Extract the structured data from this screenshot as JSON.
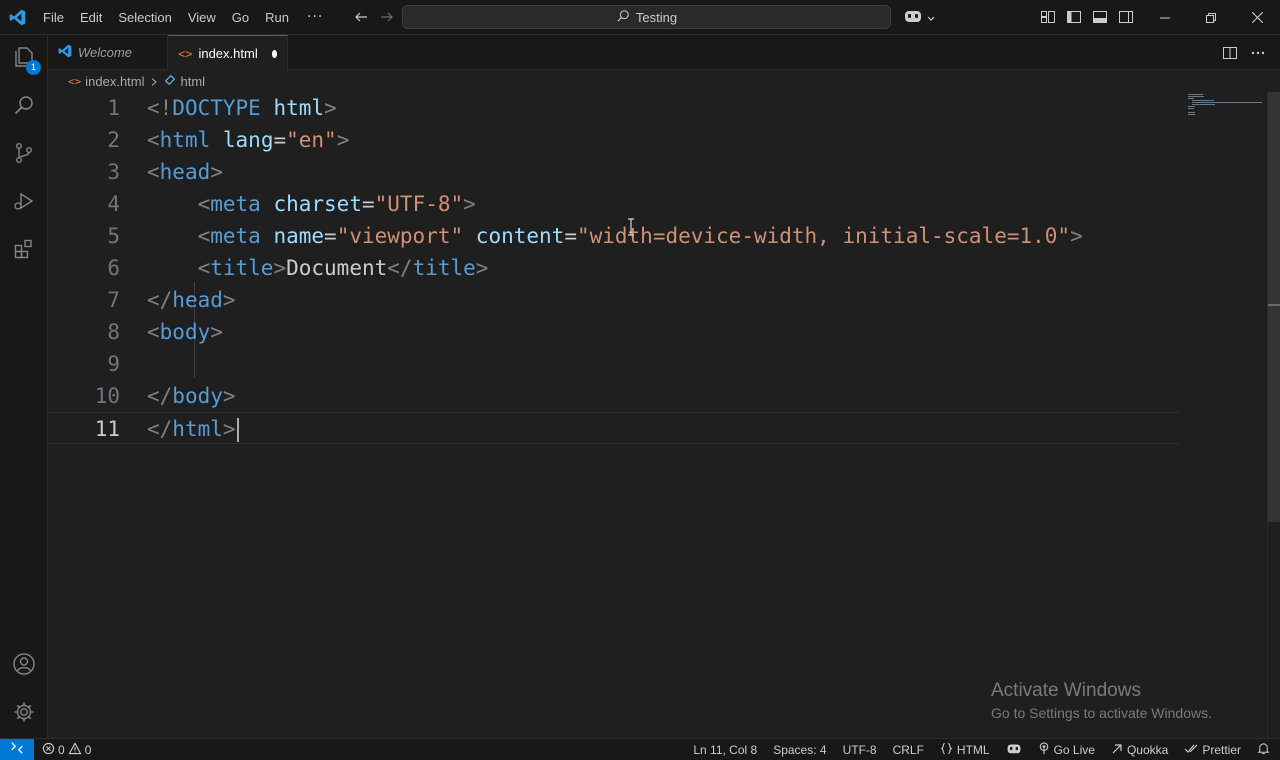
{
  "titlebar": {
    "menu": [
      "File",
      "Edit",
      "Selection",
      "View",
      "Go",
      "Run"
    ],
    "more_label": "···",
    "command_center": "Testing"
  },
  "activity_bar": {
    "explorer_badge": "1"
  },
  "tabs": [
    {
      "label": "Welcome",
      "active": false
    },
    {
      "label": "index.html",
      "active": true,
      "dirty": true
    }
  ],
  "breadcrumb": {
    "file": "index.html",
    "symbol": "html"
  },
  "editor": {
    "lines": [
      {
        "n": "1",
        "tokens": [
          [
            "punc",
            "<!"
          ],
          [
            "tag",
            "DOCTYPE"
          ],
          [
            "text",
            " "
          ],
          [
            "attr",
            "html"
          ],
          [
            "punc",
            ">"
          ]
        ]
      },
      {
        "n": "2",
        "tokens": [
          [
            "punc",
            "<"
          ],
          [
            "tag",
            "html"
          ],
          [
            "text",
            " "
          ],
          [
            "attr",
            "lang"
          ],
          [
            "text",
            "="
          ],
          [
            "str",
            "\"en\""
          ],
          [
            "punc",
            ">"
          ]
        ]
      },
      {
        "n": "3",
        "tokens": [
          [
            "punc",
            "<"
          ],
          [
            "tag",
            "head"
          ],
          [
            "punc",
            ">"
          ]
        ]
      },
      {
        "n": "4",
        "tokens": [
          [
            "text",
            "    "
          ],
          [
            "punc",
            "<"
          ],
          [
            "tag",
            "meta"
          ],
          [
            "text",
            " "
          ],
          [
            "attr",
            "charset"
          ],
          [
            "text",
            "="
          ],
          [
            "str",
            "\"UTF-8\""
          ],
          [
            "punc",
            ">"
          ]
        ]
      },
      {
        "n": "5",
        "tokens": [
          [
            "text",
            "    "
          ],
          [
            "punc",
            "<"
          ],
          [
            "tag",
            "meta"
          ],
          [
            "text",
            " "
          ],
          [
            "attr",
            "name"
          ],
          [
            "text",
            "="
          ],
          [
            "str",
            "\"viewport\""
          ],
          [
            "text",
            " "
          ],
          [
            "attr",
            "content"
          ],
          [
            "text",
            "="
          ],
          [
            "str",
            "\"width=device-width, initial-scale=1.0\""
          ],
          [
            "punc",
            ">"
          ]
        ]
      },
      {
        "n": "6",
        "tokens": [
          [
            "text",
            "    "
          ],
          [
            "punc",
            "<"
          ],
          [
            "tag",
            "title"
          ],
          [
            "punc",
            ">"
          ],
          [
            "text",
            "Document"
          ],
          [
            "punc",
            "</"
          ],
          [
            "tag",
            "title"
          ],
          [
            "punc",
            ">"
          ]
        ]
      },
      {
        "n": "7",
        "tokens": [
          [
            "punc",
            "</"
          ],
          [
            "tag",
            "head"
          ],
          [
            "punc",
            ">"
          ]
        ]
      },
      {
        "n": "8",
        "tokens": [
          [
            "punc",
            "<"
          ],
          [
            "tag",
            "body"
          ],
          [
            "punc",
            ">"
          ]
        ]
      },
      {
        "n": "9",
        "tokens": []
      },
      {
        "n": "10",
        "tokens": [
          [
            "punc",
            "</"
          ],
          [
            "tag",
            "body"
          ],
          [
            "punc",
            ">"
          ]
        ]
      },
      {
        "n": "11",
        "tokens": [
          [
            "punc",
            "</"
          ],
          [
            "tag",
            "html"
          ],
          [
            "punc",
            ">"
          ]
        ],
        "active": true
      }
    ]
  },
  "watermark": {
    "title": "Activate Windows",
    "subtitle": "Go to Settings to activate Windows."
  },
  "statusbar": {
    "errors": "0",
    "warnings": "0",
    "position": "Ln 11, Col 8",
    "spaces": "Spaces: 4",
    "encoding": "UTF-8",
    "eol": "CRLF",
    "language": "HTML",
    "go_live": "Go Live",
    "quokka": "Quokka",
    "prettier": "Prettier"
  },
  "colors": {
    "accent": "#0078d4",
    "tag": "#569cd6",
    "attribute": "#9cdcfe",
    "string": "#ce9178",
    "punctuation": "#808080"
  }
}
